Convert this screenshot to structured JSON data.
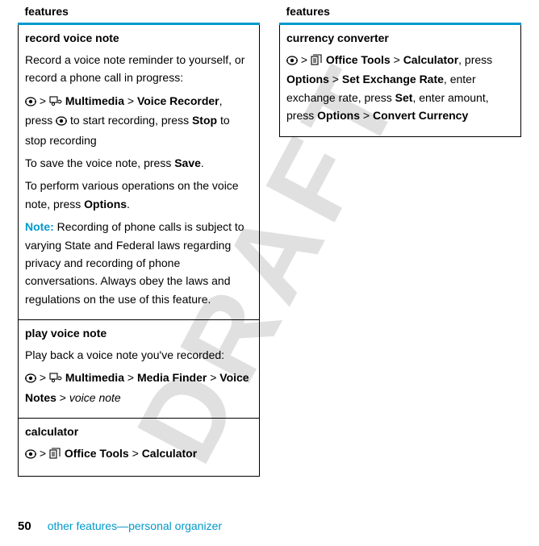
{
  "watermark": "DRAFT",
  "left": {
    "header": "features",
    "sections": [
      {
        "title": "record voice note",
        "p1": "Record a voice note reminder to yourself, or record a phone call in progress:",
        "nav": {
          "gt1": " > ",
          "multimedia": "Multimedia",
          "gt2": " > ",
          "voicerec": "Voice Recorder",
          "after": ", press ",
          "to_start": " to start recording, press ",
          "stop": "Stop",
          "to_stop": " to stop recording"
        },
        "p2a": "To save the voice note, press ",
        "save": "Save",
        "p2b": ".",
        "p3a": "To perform various operations on the voice note, press ",
        "options": "Options",
        "p3b": ".",
        "note_label": "Note:",
        "note": " Recording of phone calls is subject to varying State and Federal laws regarding privacy and recording of phone conversations. Always obey the laws and regulations on the use of this feature."
      },
      {
        "title": "play voice note",
        "p1": "Play back a voice note you've recorded:",
        "nav": {
          "gt1": " > ",
          "multimedia": "Multimedia",
          "gt2": " > ",
          "mediafinder": "Media Finder",
          "gt3": " > ",
          "voicenotes": "Voice Notes",
          "gt4": " > ",
          "vn": "voice note"
        }
      },
      {
        "title": "calculator",
        "nav": {
          "gt1": " > ",
          "office": "Office Tools",
          "gt2": " > ",
          "calc": "Calculator"
        }
      }
    ]
  },
  "right": {
    "header": "features",
    "section": {
      "title": "currency converter",
      "nav": {
        "gt1": " > ",
        "office": "Office Tools",
        "gt2": " > ",
        "calc": "Calculator",
        "press1": ", press ",
        "options1": "Options",
        "gt3": " > ",
        "setex": "Set Exchange Rate",
        "enter1": ", enter exchange rate, press ",
        "set": "Set",
        "enter2": ", enter amount, press ",
        "options2": "Options",
        "gt4": " > ",
        "convert": "Convert Currency"
      }
    }
  },
  "footer": {
    "page": "50",
    "text": "other features—personal organizer"
  }
}
